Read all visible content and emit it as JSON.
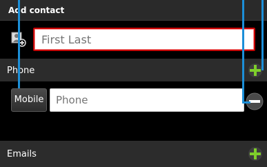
{
  "title": "Add contact",
  "name": {
    "placeholder": "First Last"
  },
  "phone_section": {
    "label": "Phone"
  },
  "phone_entry": {
    "type_label": "Mobile",
    "placeholder": "Phone"
  },
  "emails_section": {
    "label": "Emails"
  },
  "icons": {
    "contact": "contact-add-icon",
    "add": "plus-icon",
    "remove": "minus-icon"
  },
  "colors": {
    "accent_green": "#7ecf2b",
    "error_red": "#c40000",
    "callout_blue": "#1c8fd8"
  }
}
